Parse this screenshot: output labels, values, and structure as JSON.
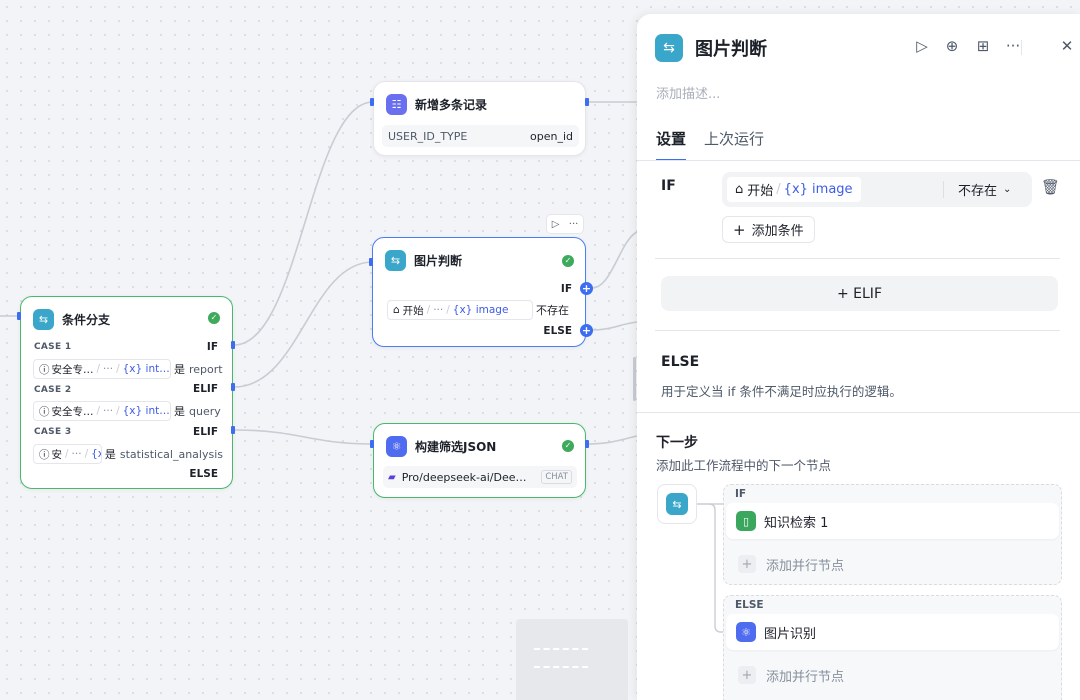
{
  "canvas": {
    "node_records": {
      "title": "新增多条记录",
      "field_name": "USER_ID_TYPE",
      "field_value": "open_id"
    },
    "node_image_judge": {
      "title": "图片判断",
      "if_label": "IF",
      "else_label": "ELSE",
      "cond_source": "开始",
      "cond_ellipsis": "···",
      "cond_var": "{x} image",
      "cond_op": "不存在",
      "toolbar_run": "▷",
      "toolbar_more": "···"
    },
    "node_condition": {
      "title": "条件分支",
      "cases": [
        {
          "case": "CASE 1",
          "branch": "IF",
          "source": "安全专…",
          "var": "{x} int…",
          "op": "是",
          "value": "report"
        },
        {
          "case": "CASE 2",
          "branch": "ELIF",
          "source": "安全专…",
          "var": "{x} int…",
          "op": "是",
          "value": "query"
        },
        {
          "case": "CASE 3",
          "branch": "ELIF",
          "source": "安",
          "var": "{x} i",
          "op": "是",
          "value": "statistical_analysis"
        }
      ],
      "ellipsis": "···",
      "else_label": "ELSE"
    },
    "node_json": {
      "title": "构建筛选JSON",
      "model": "Pro/deepseek-ai/Dee…",
      "badge": "CHAT"
    }
  },
  "panel": {
    "title": "图片判断",
    "description_placeholder": "添加描述...",
    "tabs": [
      "设置",
      "上次运行"
    ],
    "if_label": "IF",
    "condition": {
      "source": "开始",
      "var": "{x} image",
      "operator": "不存在"
    },
    "add_condition": "添加条件",
    "elif_button": "+ ELIF",
    "else_title": "ELSE",
    "else_desc": "用于定义当 if 条件不满足时应执行的逻辑。",
    "next_title": "下一步",
    "next_desc": "添加此工作流程中的下一个节点",
    "branches": [
      {
        "label": "IF",
        "node": "知识检索 1",
        "add": "添加并行节点"
      },
      {
        "label": "ELSE",
        "node": "图片识别",
        "add": "添加并行节点"
      }
    ]
  }
}
